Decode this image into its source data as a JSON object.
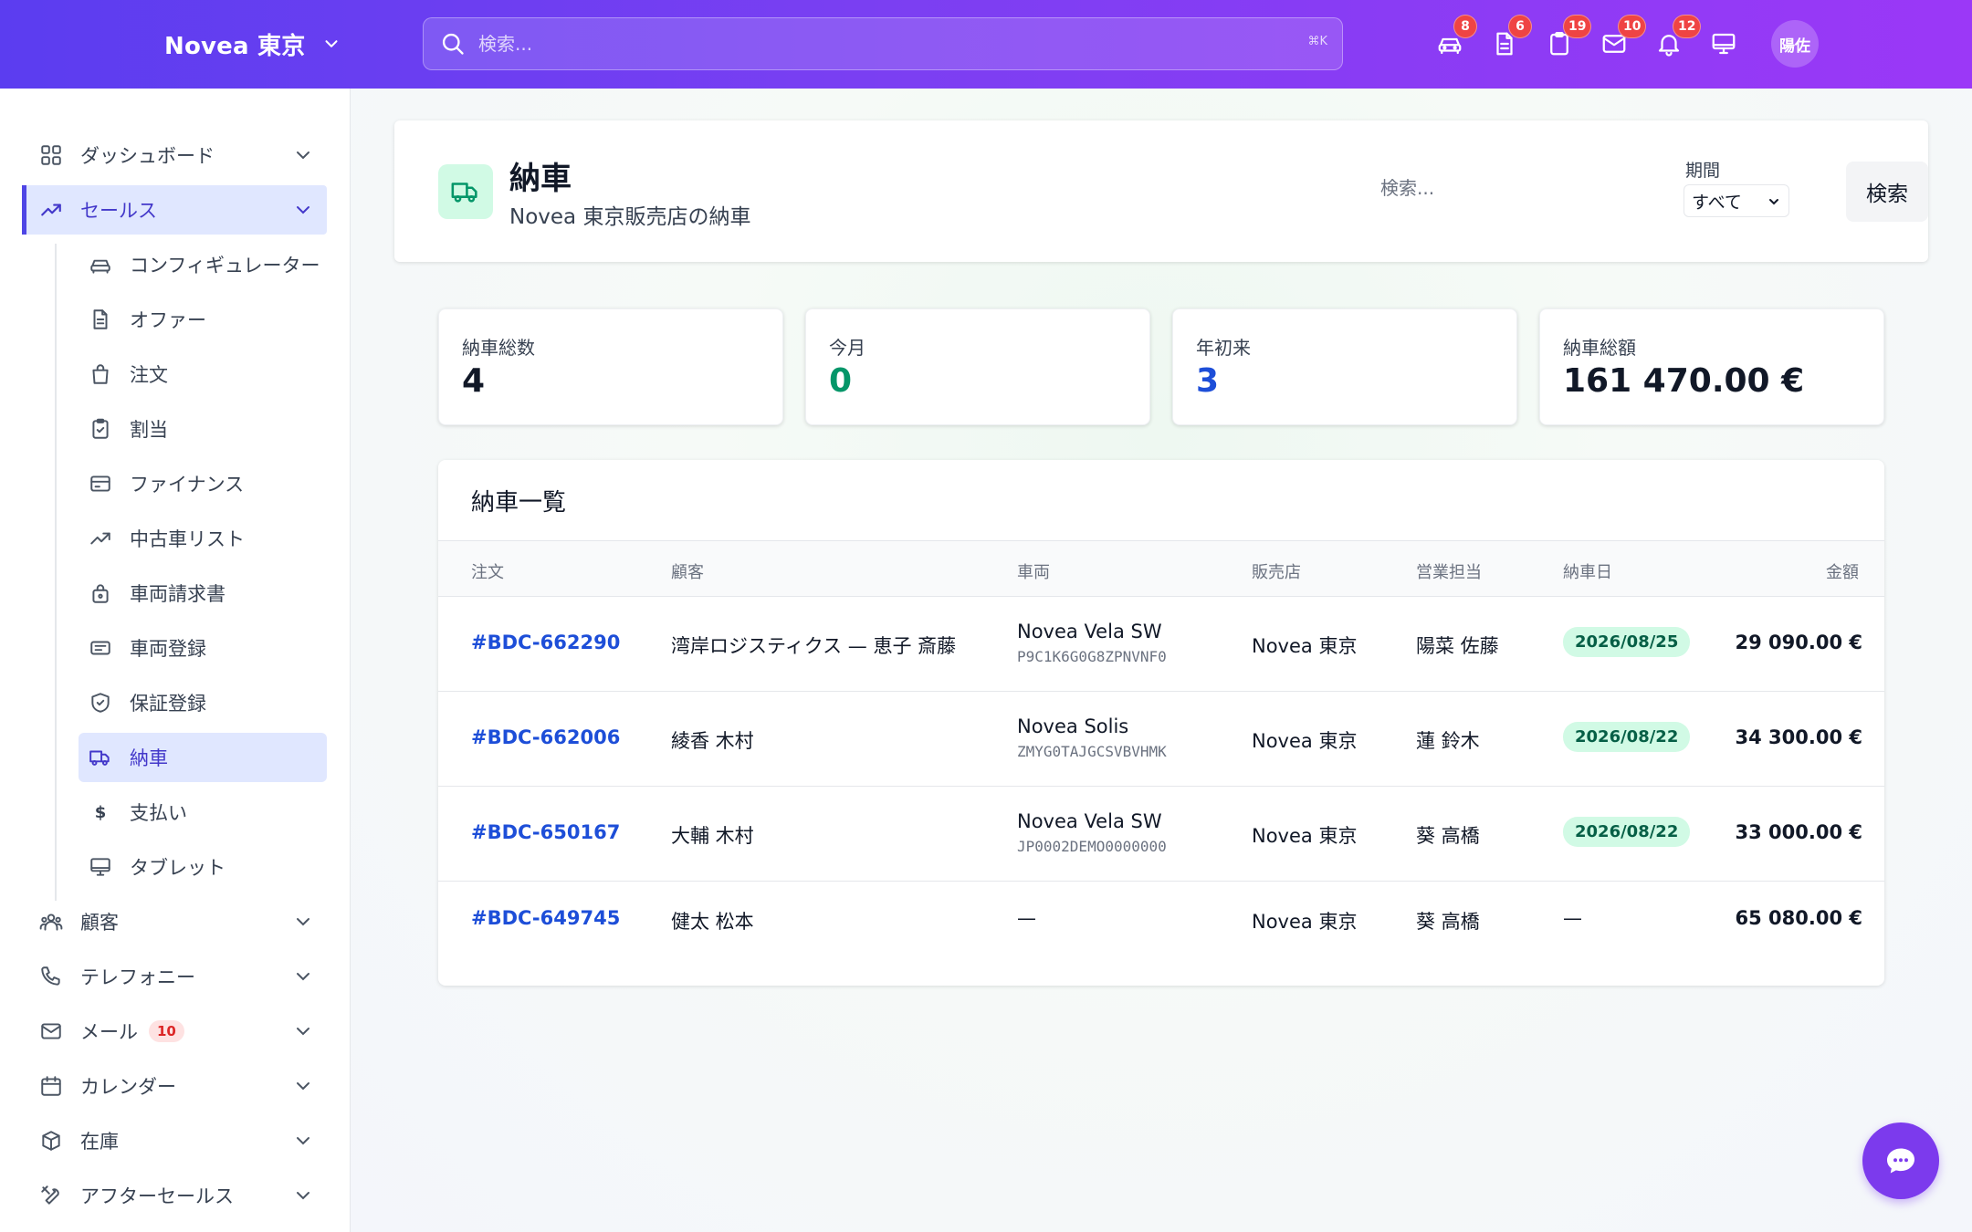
{
  "header": {
    "brand": "Novea 東京",
    "search_placeholder": "検索...",
    "search_shortcut": "⌘K",
    "user_initials": "陽佐",
    "icons": [
      {
        "name": "car-icon",
        "badge": "8"
      },
      {
        "name": "document-icon",
        "badge": "6"
      },
      {
        "name": "clipboard-icon",
        "badge": "19"
      },
      {
        "name": "mail-icon",
        "badge": "10"
      },
      {
        "name": "bell-icon",
        "badge": "12"
      },
      {
        "name": "monitor-icon",
        "badge": ""
      }
    ]
  },
  "sidebar": {
    "items": [
      {
        "label": "ダッシュボード",
        "icon": "grid-icon"
      },
      {
        "label": "セールス",
        "icon": "trending-up-icon",
        "active": true
      },
      {
        "label": "顧客",
        "icon": "users-icon"
      },
      {
        "label": "テレフォニー",
        "icon": "phone-icon"
      },
      {
        "label": "メール",
        "icon": "mail-icon",
        "badge": "10"
      },
      {
        "label": "カレンダー",
        "icon": "calendar-icon"
      },
      {
        "label": "在庫",
        "icon": "box-icon"
      },
      {
        "label": "アフターセールス",
        "icon": "tools-icon"
      }
    ],
    "sales_sub": [
      {
        "label": "コンフィギュレーター",
        "icon": "car-icon"
      },
      {
        "label": "オファー",
        "icon": "document-icon"
      },
      {
        "label": "注文",
        "icon": "bag-icon"
      },
      {
        "label": "割当",
        "icon": "clipboard-check-icon"
      },
      {
        "label": "ファイナンス",
        "icon": "credit-card-icon"
      },
      {
        "label": "中古車リスト",
        "icon": "trending-up-icon"
      },
      {
        "label": "車両請求書",
        "icon": "lock-bag-icon"
      },
      {
        "label": "車両登録",
        "icon": "id-card-icon"
      },
      {
        "label": "保証登録",
        "icon": "shield-check-icon"
      },
      {
        "label": "納車",
        "icon": "truck-icon",
        "active": true
      },
      {
        "label": "支払い",
        "icon": "dollar-icon"
      },
      {
        "label": "タブレット",
        "icon": "monitor-icon"
      }
    ]
  },
  "page": {
    "title": "納車",
    "subtitle": "Novea 東京販売店の納車",
    "search_placeholder": "検索...",
    "period_label": "期間",
    "period_value": "すべて",
    "search_button": "検索"
  },
  "stats": [
    {
      "label": "納車総数",
      "value": "4",
      "color": "#111827"
    },
    {
      "label": "今月",
      "value": "0",
      "color": "#059669"
    },
    {
      "label": "年初来",
      "value": "3",
      "color": "#1d4ed8"
    },
    {
      "label": "納車総額",
      "value": "161 470.00 €",
      "color": "#111827"
    }
  ],
  "table": {
    "title": "納車一覧",
    "columns": [
      "注文",
      "顧客",
      "車両",
      "販売店",
      "営業担当",
      "納車日",
      "金額"
    ],
    "rows": [
      {
        "order": "#BDC-662290",
        "customer": "湾岸ロジスティクス — 恵子 斎藤",
        "vehicle": "Novea Vela SW",
        "vin": "P9C1K6G0G8ZPNVNF0",
        "dealer": "Novea 東京",
        "sales": "陽菜 佐藤",
        "date": "2026/08/25",
        "amount": "29 090.00 €"
      },
      {
        "order": "#BDC-662006",
        "customer": "綾香 木村",
        "vehicle": "Novea Solis",
        "vin": "ZMYG0TAJGCSVBVHMK",
        "dealer": "Novea 東京",
        "sales": "蓮 鈴木",
        "date": "2026/08/22",
        "amount": "34 300.00 €"
      },
      {
        "order": "#BDC-650167",
        "customer": "大輔 木村",
        "vehicle": "Novea Vela SW",
        "vin": "JP0002DEMO0000000",
        "dealer": "Novea 東京",
        "sales": "葵 高橋",
        "date": "2026/08/22",
        "amount": "33 000.00 €"
      },
      {
        "order": "#BDC-649745",
        "customer": "健太 松本",
        "vehicle": "—",
        "vin": "",
        "dealer": "Novea 東京",
        "sales": "葵 高橋",
        "date": "—",
        "amount": "65 080.00 €"
      }
    ]
  },
  "colors": {
    "accent": "#4f46e5",
    "success": "#059669",
    "link": "#1d4ed8",
    "chat": "#7c3aed"
  }
}
